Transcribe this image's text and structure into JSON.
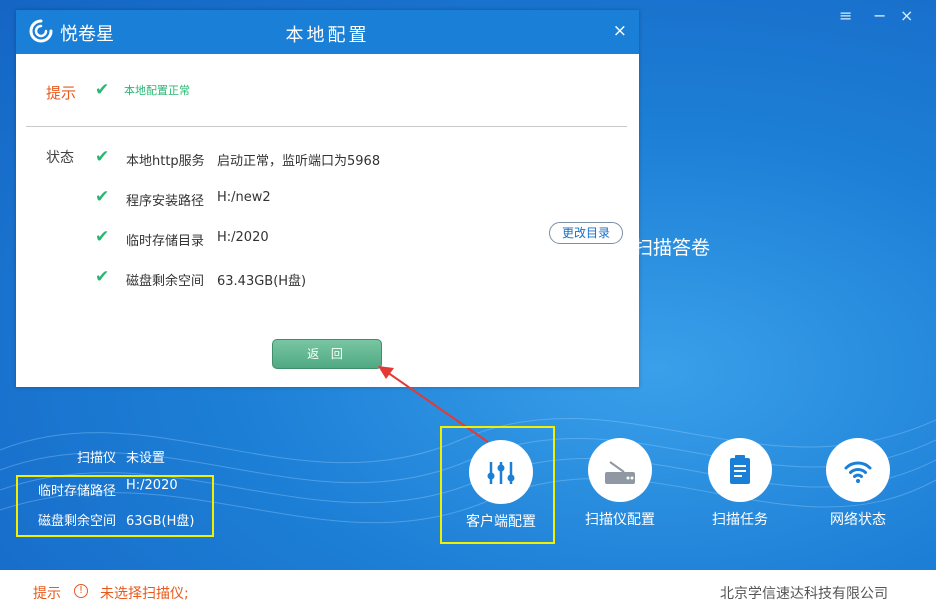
{
  "window": {
    "controls": {
      "menu": "≡",
      "minimize": "−",
      "close": "×"
    },
    "background_text": "扫描答卷"
  },
  "dialog": {
    "brand": "悦卷星",
    "title": "本地配置",
    "close": "×",
    "hint": {
      "label": "提示",
      "check": "✔",
      "message": "本地配置正常"
    },
    "status": {
      "label": "状态",
      "rows": [
        {
          "check": "✔",
          "label": "本地http服务",
          "value": "启动正常，监听端口为5968"
        },
        {
          "check": "✔",
          "label": "程序安装路径",
          "value": "H:/new2"
        },
        {
          "check": "✔",
          "label": "临时存储目录",
          "value": "H:/2020"
        },
        {
          "check": "✔",
          "label": "磁盘剩余空间",
          "value": "63.43GB(H盘)"
        }
      ]
    },
    "change_dir_button": "更改目录",
    "back_button": "返 回"
  },
  "info": {
    "scanner": {
      "label": "扫描仪",
      "value": "未设置"
    },
    "temp_path": {
      "label": "临时存储路径",
      "value": "H:/2020"
    },
    "disk_space": {
      "label": "磁盘剩余空间",
      "value": "63GB(H盘)"
    }
  },
  "tiles": [
    {
      "icon": "sliders-icon",
      "label": "客户端配置"
    },
    {
      "icon": "scanner-icon",
      "label": "扫描仪配置"
    },
    {
      "icon": "clipboard-icon",
      "label": "扫描任务"
    },
    {
      "icon": "wifi-icon",
      "label": "网络状态"
    }
  ],
  "footer": {
    "hint_label": "提示",
    "hint_icon": "!",
    "hint_message": "未选择扫描仪;",
    "company": "北京学信速达科技有限公司"
  },
  "colors": {
    "primary_blue": "#1a7fd6",
    "hint_orange": "#e8591c",
    "ok_green": "#2bb673",
    "highlight_yellow": "#f0f000",
    "arrow_red": "#e53935"
  }
}
